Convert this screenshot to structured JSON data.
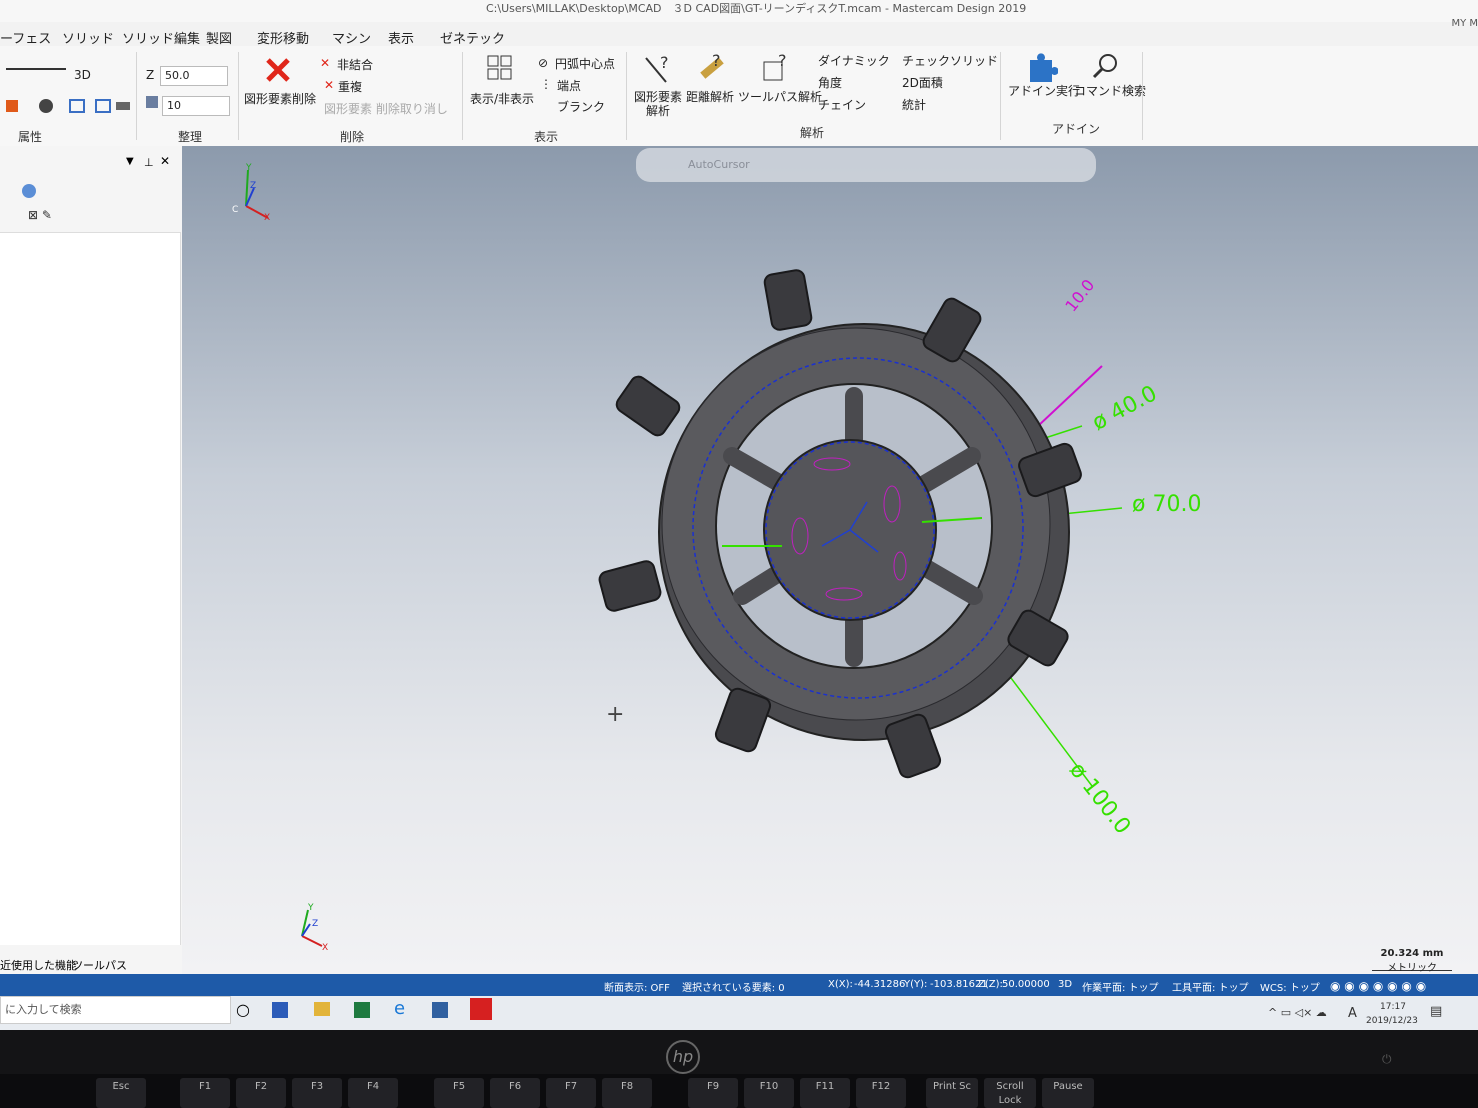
{
  "window": {
    "title": "C:\\Users\\MILLAK\\Desktop\\MCAD　３D CAD図面\\GT-リーンディスクT.mcam - Mastercam Design 2019",
    "user": "MY M"
  },
  "menu": [
    "ーフェス",
    "ソリッド",
    "ソリッド編集",
    "製図",
    "変形移動",
    "マシン",
    "表示",
    "ゼネテック"
  ],
  "ribbon": {
    "attr": {
      "mode_3d": "3D",
      "label": "属性"
    },
    "arrange": {
      "z_label": "Z",
      "z_value": "50.0",
      "level_value": "10",
      "label": "整理"
    },
    "delete": {
      "delete_entities": "図形要素削除",
      "unbind": "非結合",
      "duplicate": "重複",
      "undo_delete": "図形要素 削除取り消し",
      "label": "削除"
    },
    "display": {
      "show_hide": "表示/非表示",
      "arc_center": "円弧中心点",
      "endpoint": "端点",
      "blank": "ブランク",
      "label": "表示"
    },
    "analyze": {
      "entity_analyze_1": "図形要素",
      "entity_analyze_2": "解析",
      "distance": "距離解析",
      "toolpath": "ツールパス解析",
      "dynamic": "ダイナミック",
      "angle": "角度",
      "chain": "チェイン",
      "check_solid": "チェックソリッド",
      "area_2d": "2D面積",
      "stats": "統計",
      "label": "解析"
    },
    "addin": {
      "run": "アドイン実行",
      "command_search": "コマンド検索",
      "label": "アドイン"
    }
  },
  "panel": {
    "tab_recent": "近使用した機能",
    "tab_toolpath": "ツールパス"
  },
  "viewport": {
    "autocursor": "AutoCursor",
    "dims": {
      "d40": "ø 40.0",
      "d70": "ø 70.0",
      "d100": "ø 100.0",
      "d10": "10.0"
    },
    "triad_top": {
      "x": "X",
      "y": "Y",
      "z": "Z",
      "c": "C"
    },
    "triad_bottom": {
      "x": "X",
      "y": "Y",
      "z": "Z"
    },
    "scale": {
      "value": "20.324 mm",
      "unit": "メトリック"
    }
  },
  "status": {
    "section": "断面表示: OFF",
    "selected": "選択されている要素: 0",
    "x_label": "X(X):",
    "x_value": "-44.31286",
    "y_label": "Y(Y):",
    "y_value": "-103.81621",
    "z_label": "Z(Z):",
    "z_value": "50.00000",
    "mode": "3D",
    "cplane": "作業平面: トップ",
    "tplane": "工具平面: トップ",
    "wcs": "WCS: トップ"
  },
  "taskbar": {
    "search": "に入力して検索",
    "time": "17:17",
    "date": "2019/12/23",
    "ime": "A"
  },
  "keyboard": [
    "Esc",
    "F1",
    "F2",
    "F3",
    "F4",
    "F5",
    "F6",
    "F7",
    "F8",
    "F9",
    "F10",
    "F11",
    "F12",
    "Print Sc",
    "Scroll Lock",
    "Pause"
  ]
}
